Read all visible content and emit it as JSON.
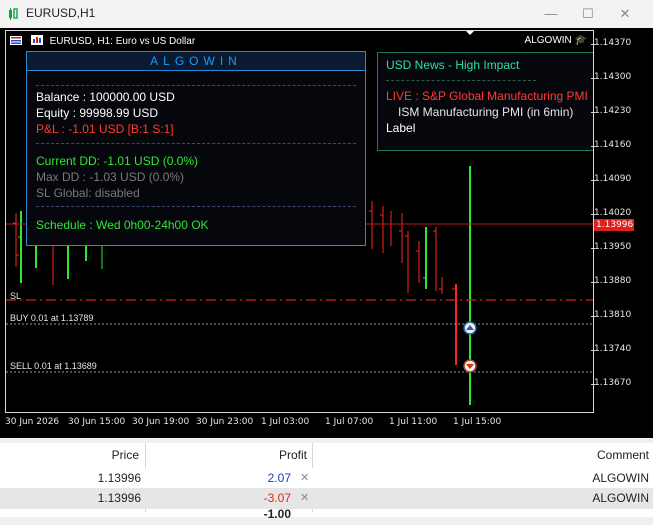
{
  "window": {
    "title": "EURUSD,H1",
    "minimize_glyph": "—",
    "maximize_glyph": "☐",
    "close_glyph": "✕"
  },
  "chart": {
    "symbol_label": "EURUSD, H1:",
    "symbol_desc": "Euro vs US Dollar",
    "ea_name": "ALGOWIN",
    "current_price_tag": "1.13996",
    "y_ticks": [
      "1.14370",
      "1.14300",
      "1.14230",
      "1.14160",
      "1.14090",
      "1.14020",
      "1.13950",
      "1.13880",
      "1.13810",
      "1.13740",
      "1.13670"
    ],
    "x_ticks": [
      "30 Jun 2026",
      "30 Jun 15:00",
      "30 Jun 19:00",
      "30 Jun 23:00",
      "1 Jul 03:00",
      "1 Jul 07:00",
      "1 Jul 11:00",
      "1 Jul 15:00"
    ],
    "lines": {
      "sl_label": "SL",
      "buy_label": "BUY 0.01 at 1.13789",
      "sell_label": "SELL 0.01 at 1.13689"
    },
    "colors": {
      "bull": "#2ee82e",
      "bear": "#ff2222",
      "sl_line": "#d42020",
      "price_line": "#c01818"
    }
  },
  "panel": {
    "title": "ALGOWIN",
    "balance": "Balance  : 100000.00 USD",
    "equity": "Equity   : 99998.99 USD",
    "pnl": "P&L : -1.01 USD  [B:1 S:1]",
    "current_dd": "Current DD: -1.01 USD  (0.0%)",
    "max_dd": "Max DD   : -1.03 USD  (0.0%)",
    "sl_global": "SL Global: disabled",
    "schedule": "Schedule : Wed 0h00-24h00 OK"
  },
  "news": {
    "title": "USD News - High Impact",
    "live": "LIVE : S&P Global Manufacturing PMI",
    "next": "ISM Manufacturing PMI  (in 6min)",
    "label": "Label"
  },
  "trades": {
    "headers": {
      "price": "Price",
      "profit": "Profit",
      "comment": "Comment"
    },
    "rows": [
      {
        "price": "1.13996",
        "profit": "2.07",
        "comment": "ALGOWIN"
      },
      {
        "price": "1.13996",
        "profit": "-3.07",
        "comment": "ALGOWIN"
      }
    ],
    "total": "-1.00"
  }
}
